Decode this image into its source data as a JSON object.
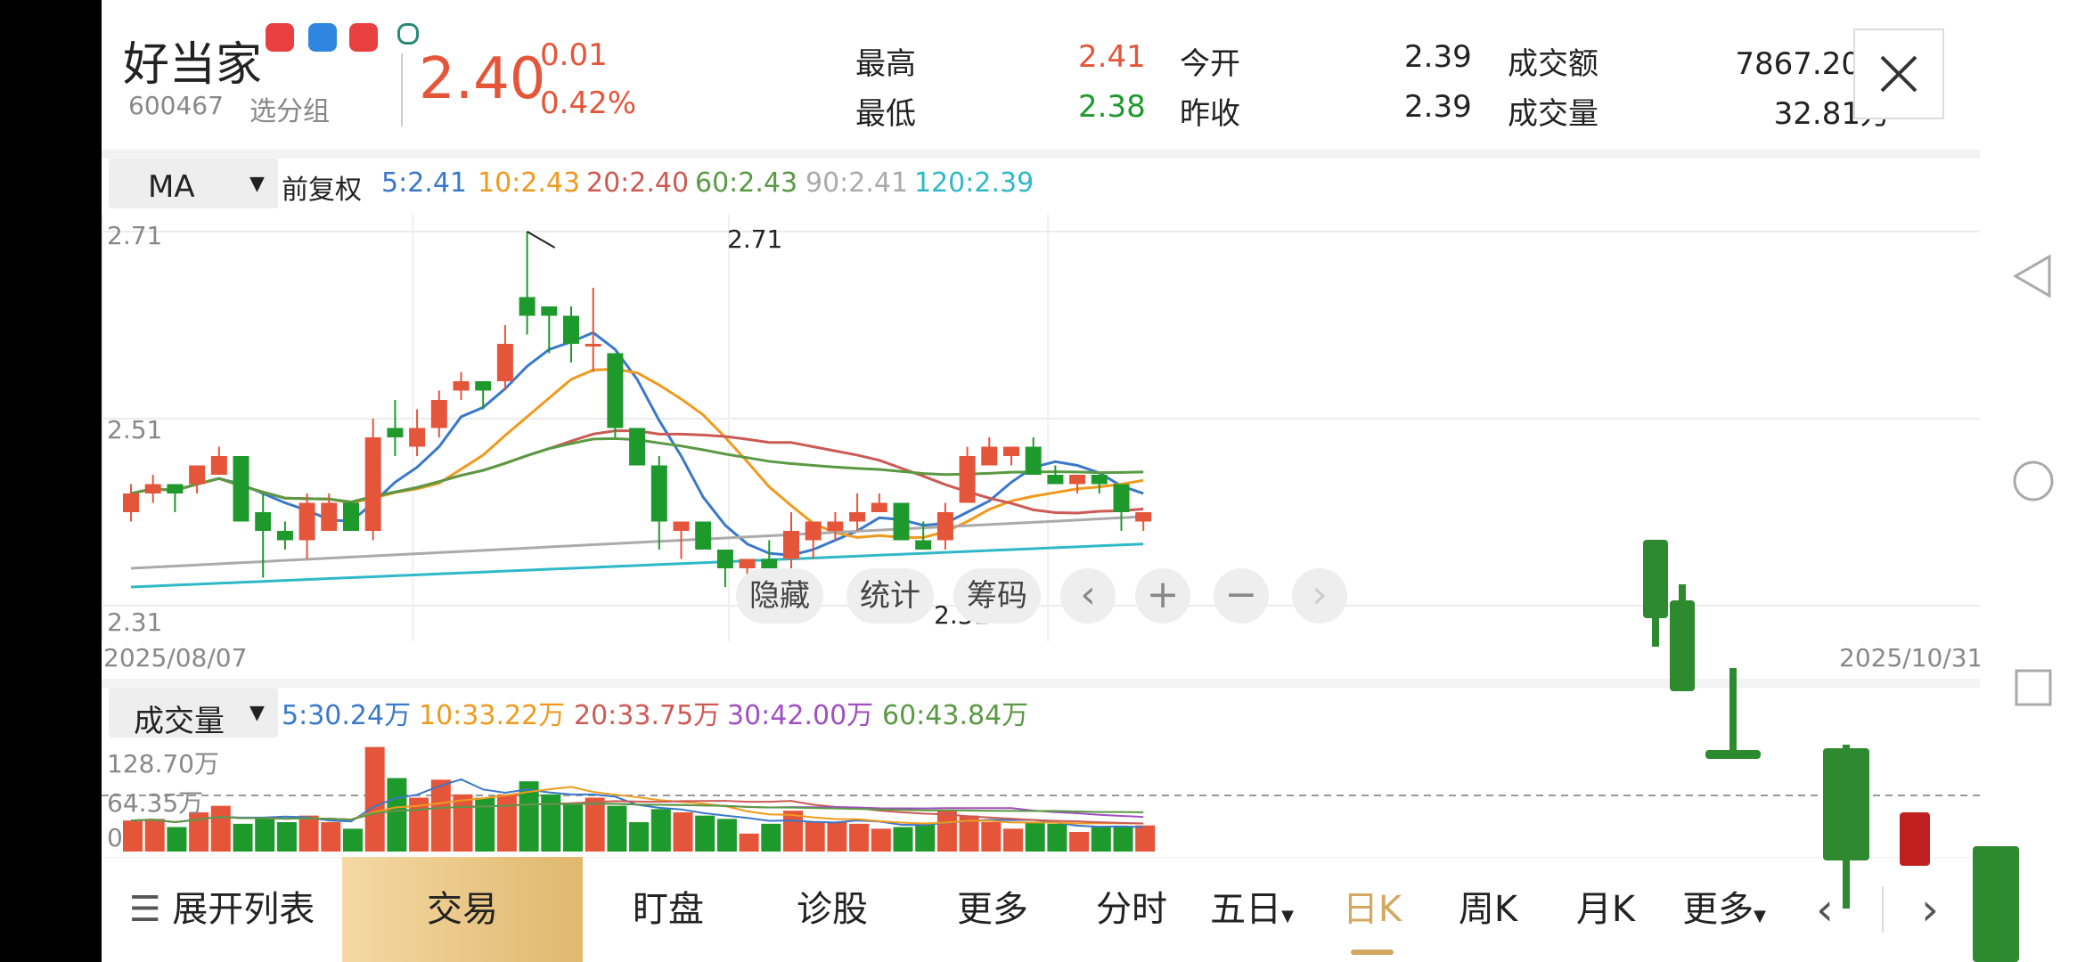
{
  "stock": {
    "name": "好当家",
    "code": "600467",
    "group": "选分组",
    "price": "2.40",
    "change": "0.01",
    "change_pct": "0.42%",
    "high_label": "最高",
    "high": "2.41",
    "low_label": "最低",
    "low": "2.38",
    "open_label": "今开",
    "open": "2.39",
    "prev_label": "昨收",
    "prev": "2.39",
    "amount_label": "成交额",
    "amount": "7867.20万",
    "volume_label": "成交量",
    "volume": "32.81万"
  },
  "ma": {
    "selector": "MA",
    "adjust": "前复权",
    "values": [
      "5:2.41",
      "10:2.43",
      "20:2.40",
      "60:2.43",
      "90:2.41",
      "120:2.39"
    ]
  },
  "volume_panel": {
    "selector": "成交量",
    "values": [
      "5:30.24万",
      "10:33.22万",
      "20:33.75万",
      "30:42.00万",
      "60:43.84万"
    ],
    "y_labels": [
      "128.70万",
      "64.35万",
      "0"
    ]
  },
  "overlay": {
    "buttons": [
      "隐藏",
      "统计",
      "筹码"
    ],
    "icons": [
      "chevron-left-icon",
      "plus-icon",
      "minus-icon",
      "chevron-right-icon"
    ]
  },
  "bottom_bar": {
    "items": [
      "展开列表",
      "交易",
      "盯盘",
      "诊股",
      "更多",
      "分时",
      "五日",
      "日K",
      "周K",
      "月K",
      "更多"
    ]
  },
  "colors": {
    "up": "#e5553a",
    "down": "#1e9a2c",
    "ma5": "#3a78c9",
    "ma10": "#ef9a1e",
    "ma20": "#cc5a55",
    "ma60": "#5a9a44",
    "ma90": "#aaaaaa",
    "ma120": "#2fb9c8",
    "trade_bg": "#e6c17f"
  },
  "chart_data": {
    "type": "candlestick",
    "title": "",
    "x_start": "2025/08/07",
    "x_end": "2025/10/31",
    "ylim": [
      2.31,
      2.71
    ],
    "y_ticks": [
      "2.71",
      "2.51",
      "2.31"
    ],
    "annotations": [
      "2.71",
      "2.31"
    ],
    "candles": [
      {
        "o": 2.41,
        "h": 2.44,
        "l": 2.4,
        "c": 2.43
      },
      {
        "o": 2.43,
        "h": 2.45,
        "l": 2.42,
        "c": 2.44
      },
      {
        "o": 2.44,
        "h": 2.44,
        "l": 2.41,
        "c": 2.43
      },
      {
        "o": 2.44,
        "h": 2.46,
        "l": 2.43,
        "c": 2.46
      },
      {
        "o": 2.45,
        "h": 2.48,
        "l": 2.45,
        "c": 2.47
      },
      {
        "o": 2.47,
        "h": 2.47,
        "l": 2.4,
        "c": 2.4
      },
      {
        "o": 2.41,
        "h": 2.43,
        "l": 2.34,
        "c": 2.39
      },
      {
        "o": 2.39,
        "h": 2.4,
        "l": 2.37,
        "c": 2.38
      },
      {
        "o": 2.38,
        "h": 2.43,
        "l": 2.36,
        "c": 2.42
      },
      {
        "o": 2.39,
        "h": 2.43,
        "l": 2.39,
        "c": 2.42
      },
      {
        "o": 2.42,
        "h": 2.42,
        "l": 2.39,
        "c": 2.39
      },
      {
        "o": 2.39,
        "h": 2.51,
        "l": 2.38,
        "c": 2.49
      },
      {
        "o": 2.5,
        "h": 2.53,
        "l": 2.47,
        "c": 2.49
      },
      {
        "o": 2.48,
        "h": 2.52,
        "l": 2.47,
        "c": 2.5
      },
      {
        "o": 2.5,
        "h": 2.54,
        "l": 2.49,
        "c": 2.53
      },
      {
        "o": 2.54,
        "h": 2.56,
        "l": 2.53,
        "c": 2.55
      },
      {
        "o": 2.55,
        "h": 2.55,
        "l": 2.52,
        "c": 2.54
      },
      {
        "o": 2.55,
        "h": 2.61,
        "l": 2.54,
        "c": 2.59
      },
      {
        "o": 2.64,
        "h": 2.71,
        "l": 2.6,
        "c": 2.62
      },
      {
        "o": 2.63,
        "h": 2.63,
        "l": 2.58,
        "c": 2.62
      },
      {
        "o": 2.62,
        "h": 2.63,
        "l": 2.57,
        "c": 2.59
      },
      {
        "o": 2.59,
        "h": 2.65,
        "l": 2.56,
        "c": 2.59
      },
      {
        "o": 2.58,
        "h": 2.58,
        "l": 2.49,
        "c": 2.5
      },
      {
        "o": 2.5,
        "h": 2.5,
        "l": 2.46,
        "c": 2.46
      },
      {
        "o": 2.46,
        "h": 2.47,
        "l": 2.37,
        "c": 2.4
      },
      {
        "o": 2.39,
        "h": 2.4,
        "l": 2.36,
        "c": 2.4
      },
      {
        "o": 2.4,
        "h": 2.4,
        "l": 2.37,
        "c": 2.37
      },
      {
        "o": 2.37,
        "h": 2.37,
        "l": 2.33,
        "c": 2.35
      },
      {
        "o": 2.35,
        "h": 2.36,
        "l": 2.31,
        "c": 2.36
      },
      {
        "o": 2.36,
        "h": 2.38,
        "l": 2.34,
        "c": 2.35
      },
      {
        "o": 2.36,
        "h": 2.41,
        "l": 2.35,
        "c": 2.39
      },
      {
        "o": 2.38,
        "h": 2.4,
        "l": 2.36,
        "c": 2.4
      },
      {
        "o": 2.39,
        "h": 2.41,
        "l": 2.38,
        "c": 2.4
      },
      {
        "o": 2.4,
        "h": 2.43,
        "l": 2.39,
        "c": 2.41
      },
      {
        "o": 2.41,
        "h": 2.43,
        "l": 2.41,
        "c": 2.42
      },
      {
        "o": 2.42,
        "h": 2.42,
        "l": 2.38,
        "c": 2.38
      },
      {
        "o": 2.38,
        "h": 2.4,
        "l": 2.37,
        "c": 2.37
      },
      {
        "o": 2.38,
        "h": 2.42,
        "l": 2.37,
        "c": 2.41
      },
      {
        "o": 2.42,
        "h": 2.48,
        "l": 2.42,
        "c": 2.47
      },
      {
        "o": 2.46,
        "h": 2.49,
        "l": 2.46,
        "c": 2.48
      },
      {
        "o": 2.47,
        "h": 2.48,
        "l": 2.46,
        "c": 2.48
      },
      {
        "o": 2.48,
        "h": 2.49,
        "l": 2.45,
        "c": 2.45
      },
      {
        "o": 2.45,
        "h": 2.46,
        "l": 2.44,
        "c": 2.44
      },
      {
        "o": 2.44,
        "h": 2.45,
        "l": 2.43,
        "c": 2.45
      },
      {
        "o": 2.45,
        "h": 2.45,
        "l": 2.43,
        "c": 2.44
      },
      {
        "o": 2.44,
        "h": 2.44,
        "l": 2.39,
        "c": 2.41
      },
      {
        "o": 2.4,
        "h": 2.41,
        "l": 2.39,
        "c": 2.41
      }
    ],
    "volumes": [
      38,
      40,
      30,
      48,
      56,
      34,
      40,
      36,
      44,
      36,
      28,
      128,
      90,
      66,
      88,
      70,
      66,
      70,
      86,
      70,
      58,
      66,
      56,
      36,
      52,
      48,
      44,
      40,
      22,
      34,
      50,
      36,
      36,
      34,
      28,
      30,
      34,
      50,
      44,
      36,
      28,
      36,
      34,
      24,
      30,
      30,
      32
    ]
  }
}
